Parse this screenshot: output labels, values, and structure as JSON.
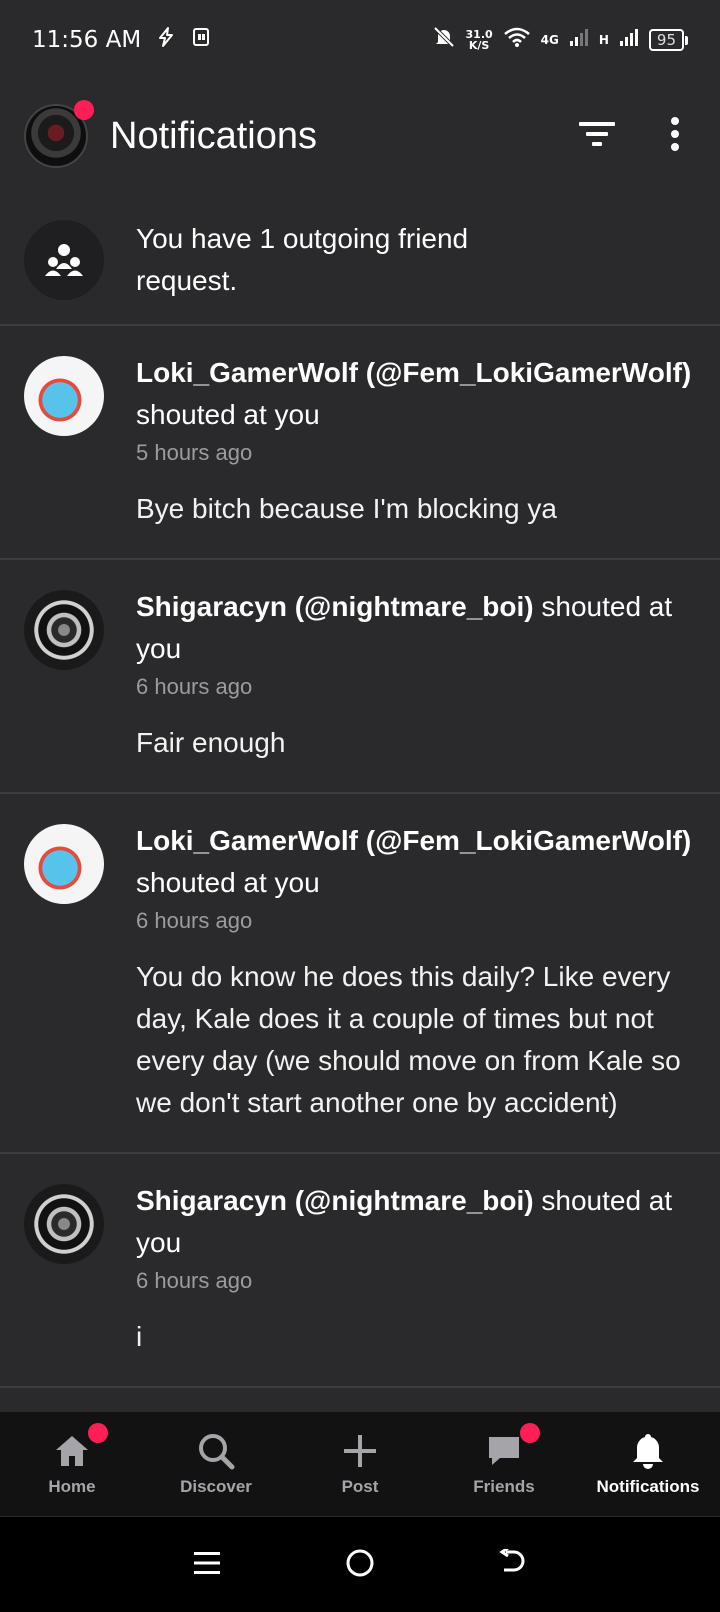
{
  "status_bar": {
    "time": "11:56 AM",
    "net_speed_value": "31.0",
    "net_speed_unit": "K/S",
    "network_4g": "4G",
    "network_h": "H",
    "battery": "95"
  },
  "header": {
    "title": "Notifications"
  },
  "friend_request": {
    "text": "You have 1 outgoing friend request."
  },
  "notifications": [
    {
      "user": "Loki_GamerWolf (@Fem_LokiGamerWolf)",
      "action": " shouted at you",
      "time": "5 hours ago",
      "message": "Bye bitch because I'm blocking ya"
    },
    {
      "user": "Shigaracyn (@nightmare_boi)",
      "action": " shouted at you",
      "time": "6 hours ago",
      "message": "Fair enough"
    },
    {
      "user": "Loki_GamerWolf (@Fem_LokiGamerWolf)",
      "action": " shouted at you",
      "time": "6 hours ago",
      "message": "You do know he does this daily? Like every day, Kale does it a couple of times but not every day (we should move on from Kale so we don't start another one by accident)"
    },
    {
      "user": "Shigaracyn (@nightmare_boi)",
      "action": " shouted at you",
      "time": "6 hours ago",
      "message": "i"
    }
  ],
  "bottom_nav": {
    "home": "Home",
    "discover": "Discover",
    "post": "Post",
    "friends": "Friends",
    "notifications": "Notifications"
  },
  "colors": {
    "background": "#2a292b",
    "accent_dot": "#ff1f55",
    "nav_background": "#121212"
  }
}
